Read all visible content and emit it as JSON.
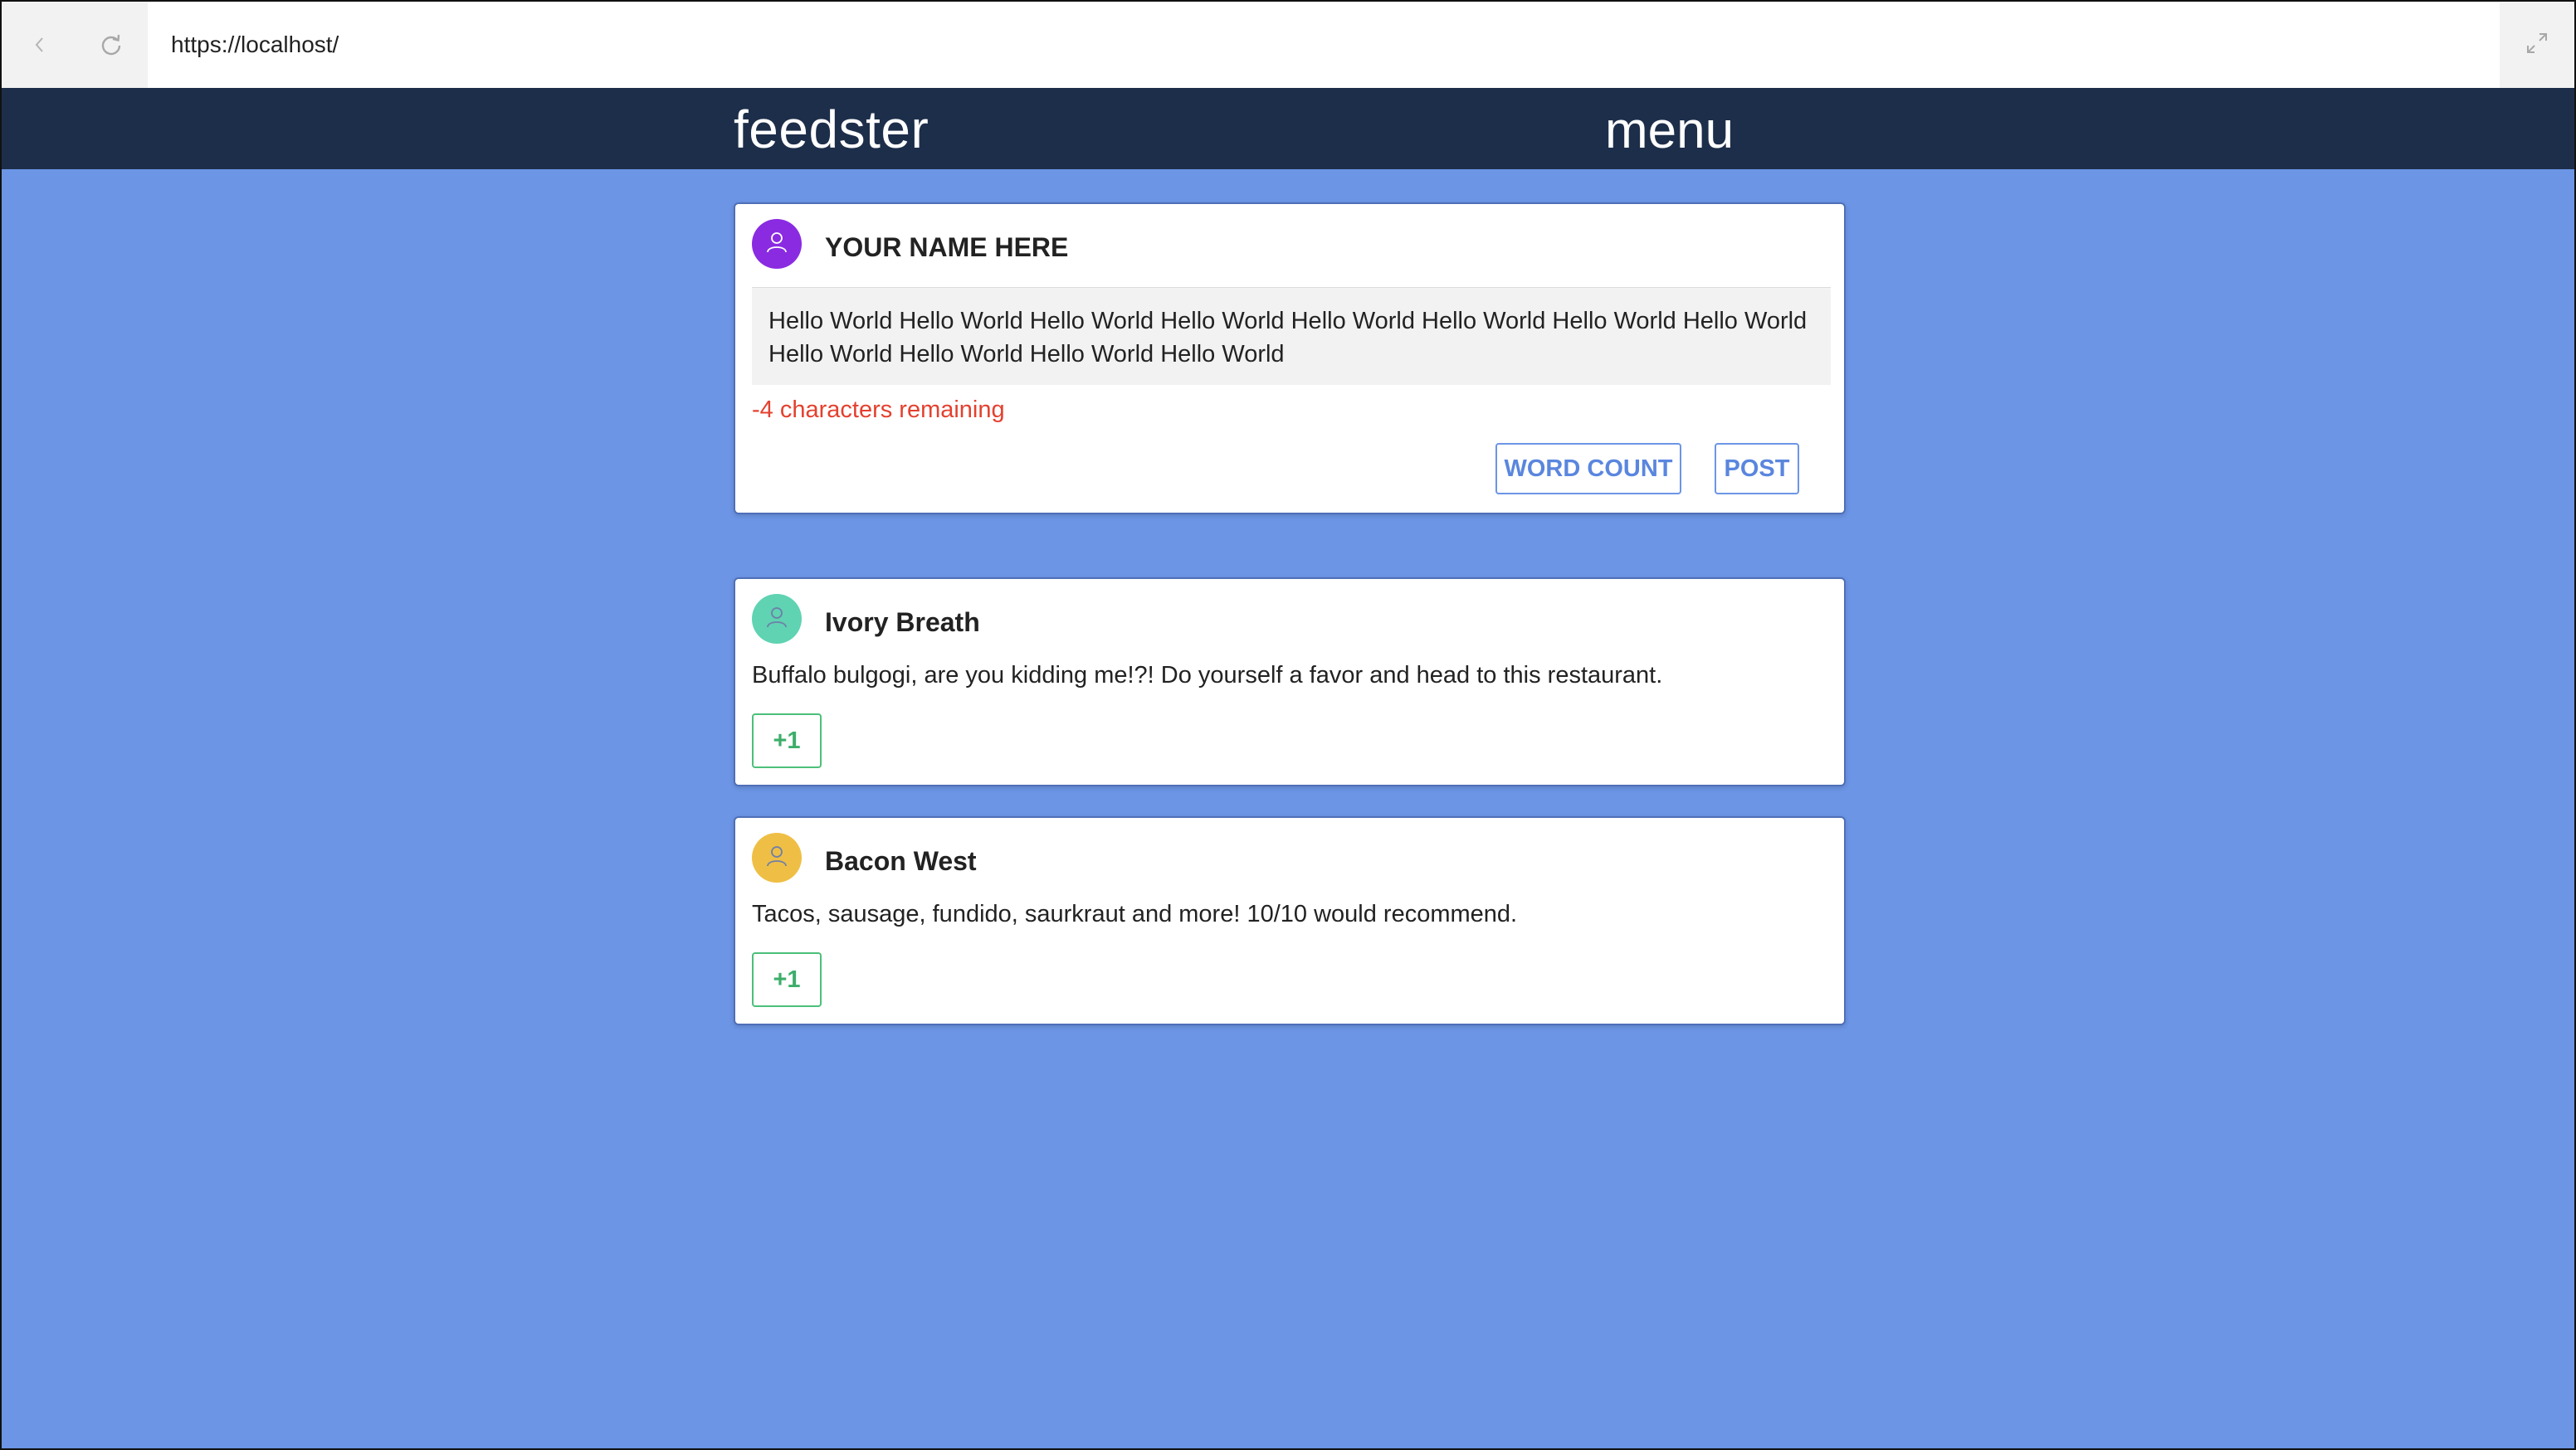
{
  "browser": {
    "url": "https://localhost/",
    "back_icon": "chevron-left-icon",
    "reload_icon": "reload-icon",
    "expand_icon": "expand-icon"
  },
  "header": {
    "brand": "feedster",
    "menu_label": "menu",
    "background": "#1d2e4a"
  },
  "composer": {
    "name": "YOUR NAME HERE",
    "avatar_color": "#8a2be2",
    "text": "Hello World Hello World Hello World Hello World Hello World Hello World Hello World Hello World Hello World Hello World Hello World Hello World",
    "char_status": "-4 characters remaining",
    "char_status_color": "#e3412f",
    "word_count_label": "WORD COUNT",
    "post_label": "POST"
  },
  "feed": {
    "posts": [
      {
        "author": "Ivory Breath",
        "avatar_color": "#5fd3b2",
        "body": "Buffalo bulgogi, are you kidding me!?! Do yourself a favor and head to this restaurant.",
        "vote_label": "+1"
      },
      {
        "author": "Bacon West",
        "avatar_color": "#efbf45",
        "body": "Tacos, sausage, fundido, saurkraut and more! 10/10 would recommend.",
        "vote_label": "+1"
      }
    ]
  },
  "colors": {
    "page_background": "#6c95e5",
    "accent": "#5a86de",
    "vote_green": "#3cae6a"
  }
}
